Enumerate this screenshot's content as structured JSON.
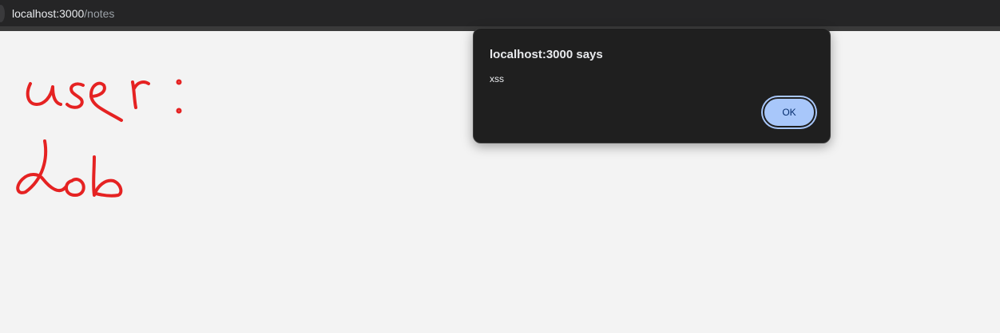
{
  "browser": {
    "url_host": "localhost:3000",
    "url_path": "/notes"
  },
  "page": {
    "handwritten_text": "user: dob"
  },
  "dialog": {
    "title": "localhost:3000 says",
    "message": "xss",
    "ok_label": "OK"
  },
  "colors": {
    "ink": "#e52222",
    "dialog_bg": "#1f1f1f",
    "ok_button_bg": "#a8c7fa"
  }
}
